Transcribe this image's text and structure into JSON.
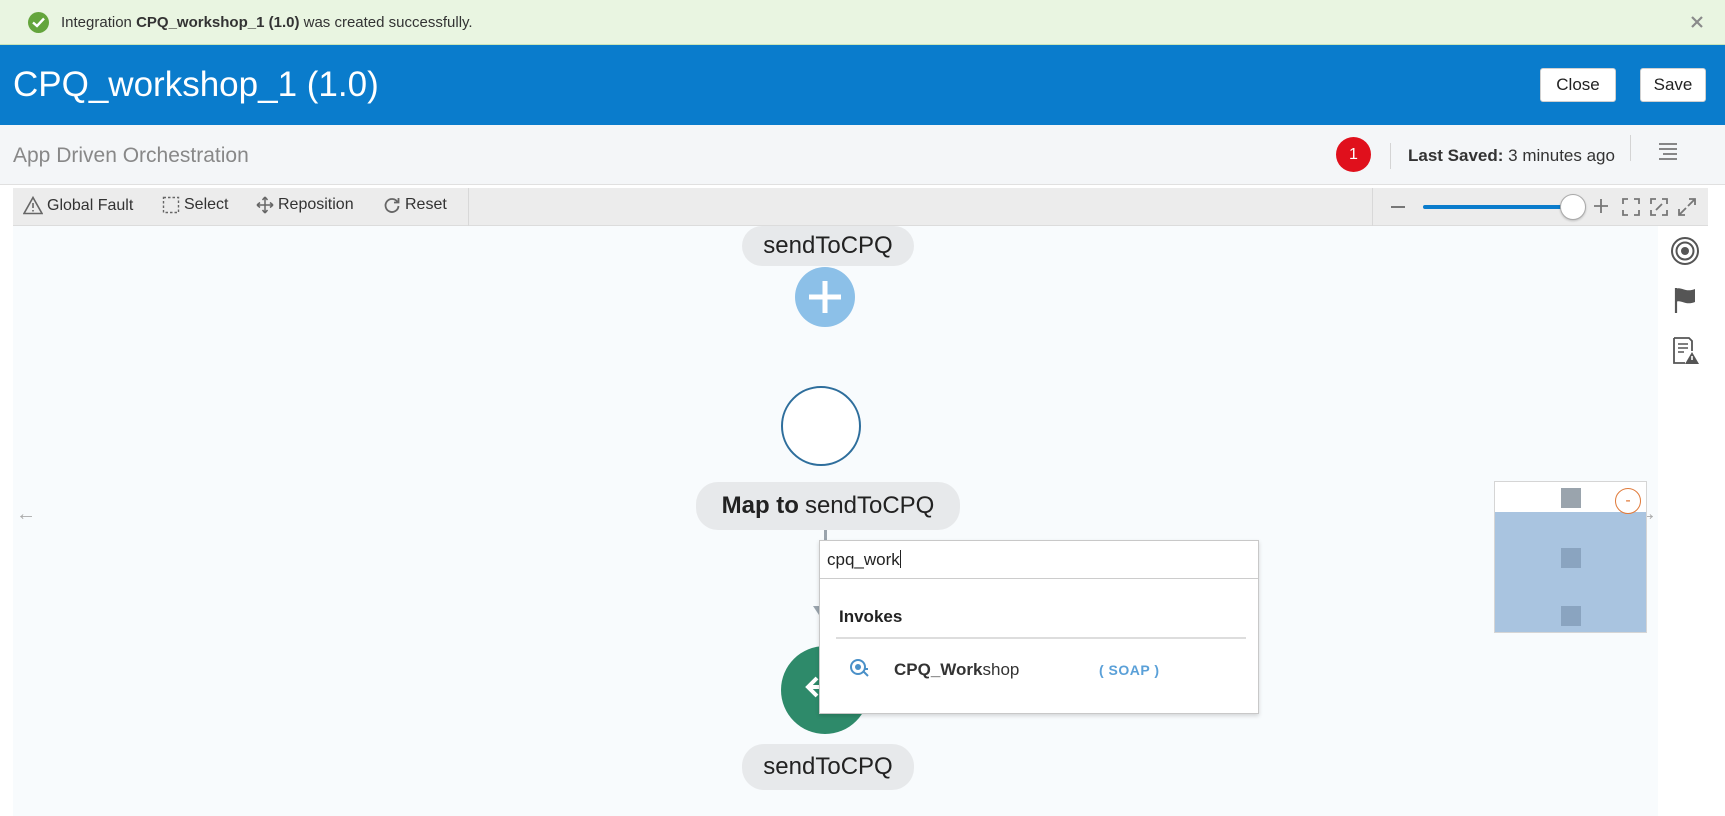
{
  "banner": {
    "icon": "check-circle-icon",
    "prefix": "Integration ",
    "bold": "CPQ_workshop_1 (1.0)",
    "suffix": " was created successfully.",
    "close_icon": "close-icon"
  },
  "header": {
    "title": "CPQ_workshop_1 (1.0)",
    "close_label": "Close",
    "save_label": "Save"
  },
  "subheader": {
    "title": "App Driven Orchestration",
    "error_count": "1",
    "last_saved_label": "Last Saved:",
    "last_saved_value": "3 minutes ago"
  },
  "toolbar": {
    "global_fault": "Global Fault",
    "select": "Select",
    "reposition": "Reposition",
    "reset": "Reset"
  },
  "canvas": {
    "top_node_label": "sendToCPQ",
    "map_prefix": "Map to",
    "map_target": "sendToCPQ",
    "bottom_node_label": "sendToCPQ",
    "left_arrow": "←",
    "right_arrow": "→"
  },
  "popup": {
    "search_value": "cpq_work",
    "group_label": "Invokes",
    "option": {
      "match": "CPQ_Work",
      "rest": "shop",
      "type": "( SOAP )"
    }
  },
  "minimap": {
    "collapse_label": "-"
  },
  "colors": {
    "header_blue": "#0a7ccc",
    "banner_green": "#e9f5e1",
    "success_icon": "#64a53c",
    "error_badge": "#e0101c",
    "return_node": "#2e8a6a",
    "add_node": "#8cc0e8"
  }
}
